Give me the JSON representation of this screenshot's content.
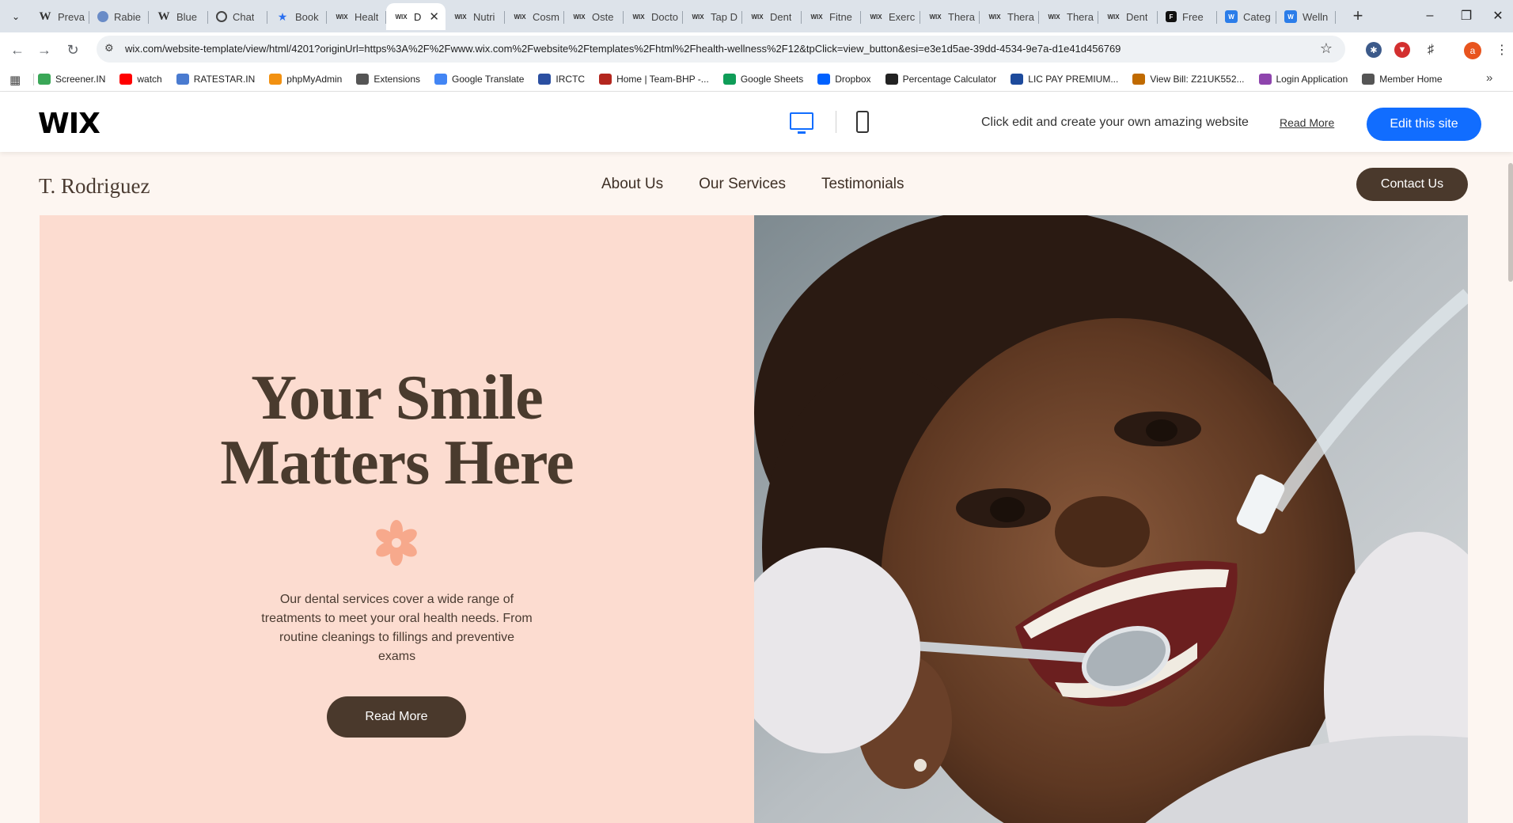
{
  "browser": {
    "tabs": [
      {
        "title": "Preva",
        "icon": "wiki"
      },
      {
        "title": "Rabie",
        "icon": "globe"
      },
      {
        "title": "Blue",
        "icon": "wiki"
      },
      {
        "title": "Chat",
        "icon": "chat"
      },
      {
        "title": "Book",
        "icon": "star"
      },
      {
        "title": "Healt",
        "icon": "wix"
      },
      {
        "title": "D",
        "icon": "wix",
        "active": true
      },
      {
        "title": "Nutri",
        "icon": "wix"
      },
      {
        "title": "Cosm",
        "icon": "wix"
      },
      {
        "title": "Oste",
        "icon": "wix"
      },
      {
        "title": "Docto",
        "icon": "wix"
      },
      {
        "title": "Tap D",
        "icon": "wix"
      },
      {
        "title": "Dent",
        "icon": "wix"
      },
      {
        "title": "Fitne",
        "icon": "wix"
      },
      {
        "title": "Exerc",
        "icon": "wix"
      },
      {
        "title": "Thera",
        "icon": "wix"
      },
      {
        "title": "Thera",
        "icon": "wix"
      },
      {
        "title": "Thera",
        "icon": "wix"
      },
      {
        "title": "Dent",
        "icon": "wix"
      },
      {
        "title": "Free",
        "icon": "black"
      },
      {
        "title": "Categ",
        "icon": "blue"
      },
      {
        "title": "Welln",
        "icon": "blue"
      }
    ],
    "url": "wix.com/website-template/view/html/4201?originUrl=https%3A%2F%2Fwww.wix.com%2Fwebsite%2Ftemplates%2Fhtml%2Fhealth-wellness%2F12&tpClick=view_button&esi=e3e1d5ae-39dd-4534-9e7a-d1e41d456769",
    "profile_initial": "a",
    "bookmarks": [
      {
        "label": "Screener.IN",
        "color": "#3aa757"
      },
      {
        "label": "watch",
        "color": "#ff0000"
      },
      {
        "label": "RATESTAR.IN",
        "color": "#4a7bd0"
      },
      {
        "label": "phpMyAdmin",
        "color": "#f29111"
      },
      {
        "label": "Extensions",
        "color": "#555555"
      },
      {
        "label": "Google Translate",
        "color": "#4285f4"
      },
      {
        "label": "IRCTC",
        "color": "#2b4fa1"
      },
      {
        "label": "Home | Team-BHP -...",
        "color": "#b3261e"
      },
      {
        "label": "Google Sheets",
        "color": "#0f9d58"
      },
      {
        "label": "Dropbox",
        "color": "#0061fe"
      },
      {
        "label": "Percentage Calculator",
        "color": "#222222"
      },
      {
        "label": "LIC PAY PREMIUM...",
        "color": "#1d4a9c"
      },
      {
        "label": "View Bill: Z21UK552...",
        "color": "#c06a00"
      },
      {
        "label": "Login Application",
        "color": "#8e44ad"
      },
      {
        "label": "Member Home",
        "color": "#555555"
      }
    ]
  },
  "wixbar": {
    "logo": "WIX",
    "message": "Click edit and create your own amazing website",
    "read_more": "Read More",
    "edit_button": "Edit this site",
    "accent": "#116dff"
  },
  "site": {
    "logo": "T. Rodriguez",
    "nav": [
      "About Us",
      "Our Services",
      "Testimonials"
    ],
    "contact_button": "Contact Us",
    "hero": {
      "title_line1": "Your Smile",
      "title_line2": "Matters Here",
      "description": "Our dental services cover a wide range of treatments to meet your oral health needs. From routine cleanings to fillings and preventive exams",
      "button": "Read More"
    },
    "colors": {
      "hero_panel": "#fcdcd0",
      "dark_brown": "#4a392c",
      "flower": "#f7a98c",
      "page_bg": "#fdf6f1"
    }
  }
}
